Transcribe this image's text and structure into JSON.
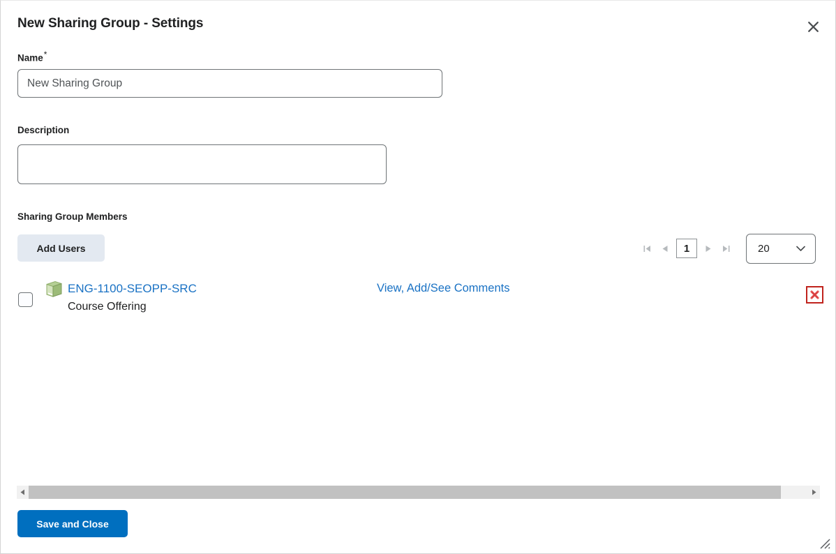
{
  "dialog": {
    "title": "New Sharing Group - Settings",
    "close_icon": "close-icon"
  },
  "form": {
    "name": {
      "label": "Name",
      "required_marker": "*",
      "value": "New Sharing Group",
      "placeholder": "New Sharing Group"
    },
    "description": {
      "label": "Description",
      "value": "",
      "placeholder": ""
    }
  },
  "members_section": {
    "label": "Sharing Group Members",
    "add_users_label": "Add Users"
  },
  "pager": {
    "first_icon": "first-page-icon",
    "prev_icon": "previous-page-icon",
    "current_page": "1",
    "next_icon": "next-page-icon",
    "last_icon": "last-page-icon",
    "page_size_value": "20",
    "page_size_options": [
      "20"
    ],
    "chevron_icon": "chevron-down-icon"
  },
  "members": [
    {
      "icon": "course-offering-book-icon",
      "title": "ENG-1100-SEOPP-SRC",
      "subtitle": "Course Offering",
      "comments_link": "View, Add/See Comments",
      "delete_icon": "delete-x-icon",
      "selected": false
    }
  ],
  "scrollbar": {
    "left_arrow_icon": "scroll-left-icon",
    "right_arrow_icon": "scroll-right-icon"
  },
  "footer": {
    "save_label": "Save and Close",
    "resize_icon": "resize-grip-icon"
  },
  "colors": {
    "link": "#1a72c4",
    "primary_button": "#006fbf",
    "secondary_button": "#e3e9f1",
    "danger": "#c0231d",
    "text": "#202122",
    "border": "#6e7376"
  }
}
